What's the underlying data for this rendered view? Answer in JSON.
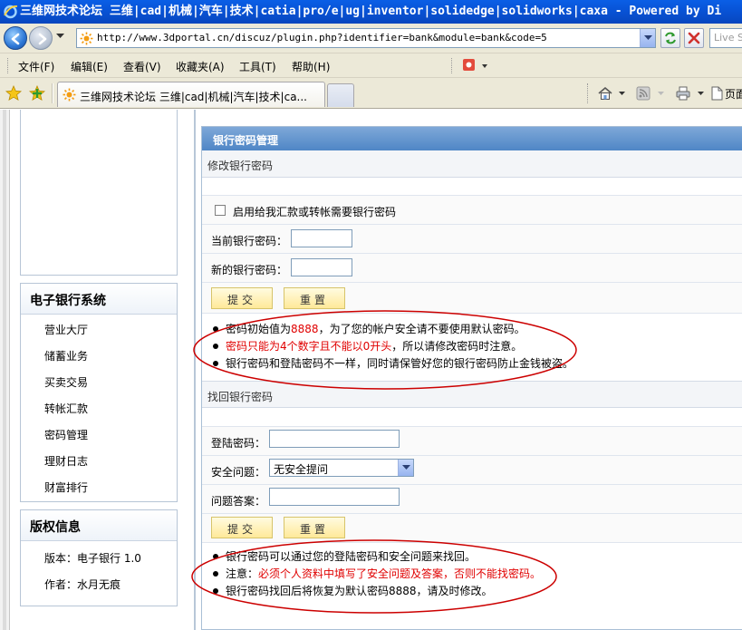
{
  "window": {
    "title": "三维网技术论坛 三维|cad|机械|汽车|技术|catia|pro/e|ug|inventor|solidedge|solidworks|caxa - Powered by Di"
  },
  "address_bar": {
    "url": "http://www.3dportal.cn/discuz/plugin.php?identifier=bank&module=bank&code=5",
    "search_placeholder": "Live S"
  },
  "menu": {
    "items": [
      "文件(F)",
      "编辑(E)",
      "查看(V)",
      "收藏夹(A)",
      "工具(T)",
      "帮助(H)"
    ]
  },
  "tabs": {
    "active_label": "三维网技术论坛 三维|cad|机械|汽车|技术|ca...",
    "page_label": "页面"
  },
  "sidebar": {
    "bank_title": "电子银行系统",
    "bank_items": [
      "营业大厅",
      "储蓄业务",
      "买卖交易",
      "转帐汇款",
      "密码管理",
      "理财日志",
      "财富排行"
    ],
    "copyright_title": "版权信息",
    "version_label": "版本：",
    "version_value": "电子银行 1.0",
    "author_label": "作者：",
    "author_value": "水月无痕"
  },
  "main": {
    "header": "银行密码管理",
    "change_section": {
      "title": "修改银行密码",
      "checkbox_label": "启用给我汇款或转帐需要银行密码",
      "checkbox_checked": false,
      "current_password_label": "当前银行密码：",
      "current_password_value": "",
      "new_password_label": "新的银行密码：",
      "new_password_value": "",
      "submit_label": "提交",
      "reset_label": "重置",
      "notes": {
        "n1_a": "密码初始值为",
        "n1_b": "8888",
        "n1_c": "，为了您的帐户安全请不要使用默认密码。",
        "n2_a": "密码只能为4个数字且不能以0开头",
        "n2_b": "，所以请修改密码时注意。",
        "n3": "银行密码和登陆密码不一样，同时请保管好您的银行密码防止金钱被盗。"
      }
    },
    "recover_section": {
      "title": "找回银行密码",
      "login_password_label": "登陆密码：",
      "login_password_value": "",
      "security_question_label": "安全问题：",
      "security_question_value": "无安全提问",
      "answer_label": "问题答案：",
      "answer_value": "",
      "submit_label": "提交",
      "reset_label": "重置",
      "notes": {
        "n1": "银行密码可以通过您的登陆密码和安全问题来找回。",
        "n2_a": "注意：",
        "n2_b": "必须个人资料中填写了安全问题及答案，否则不能找密码。",
        "n3": "银行密码找回后将恢复为默认密码8888，请及时修改。"
      }
    }
  },
  "colors": {
    "titlebar": "#0853d6",
    "panel_header": "#4f86c6",
    "button_fill": "#ffe999",
    "highlight_text": "#e00000",
    "annotation_ellipse": "#cc0000"
  }
}
